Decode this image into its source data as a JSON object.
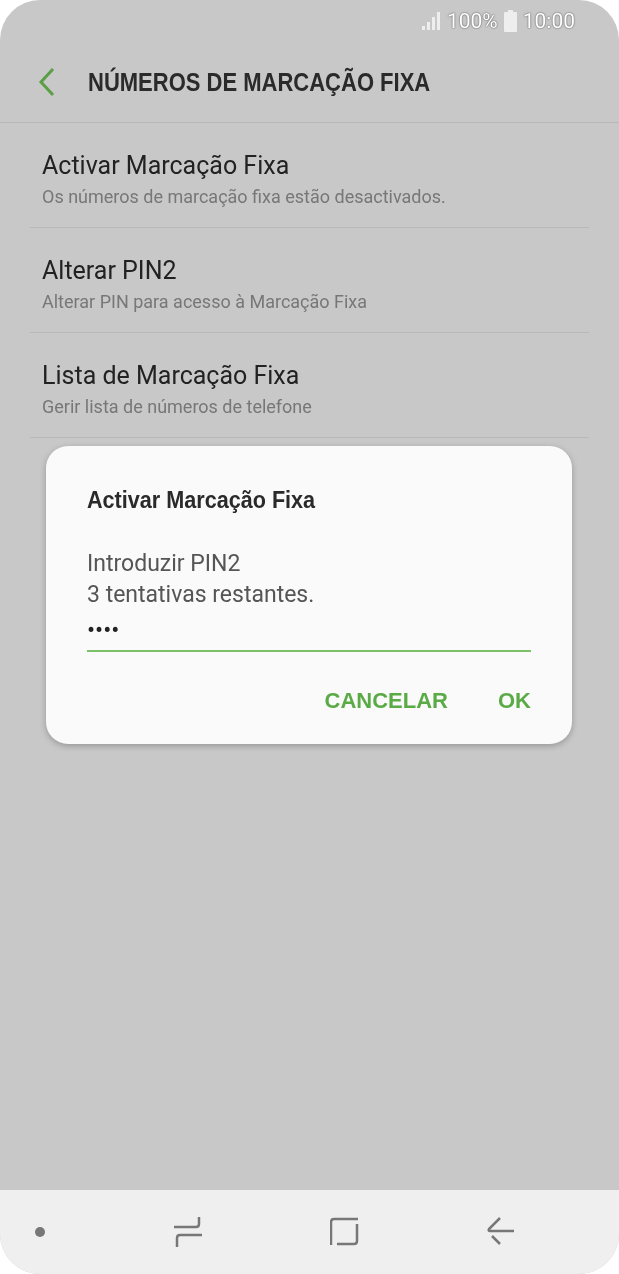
{
  "status_bar": {
    "battery": "100%",
    "time": "10:00"
  },
  "toolbar": {
    "title": "NÚMEROS DE MARCAÇÃO FIXA"
  },
  "settings": [
    {
      "title": "Activar Marcação Fixa",
      "subtitle": "Os números de marcação fixa estão desactivados."
    },
    {
      "title": "Alterar PIN2",
      "subtitle": "Alterar PIN para acesso à Marcação Fixa"
    },
    {
      "title": "Lista de Marcação Fixa",
      "subtitle": "Gerir lista de números de telefone"
    }
  ],
  "dialog": {
    "title": "Activar Marcação Fixa",
    "message_lines": [
      "Introduzir PIN2",
      "3 tentativas restantes."
    ],
    "pin_field": {
      "value": "••••"
    },
    "buttons": [
      "CANCELAR",
      "OK"
    ]
  }
}
